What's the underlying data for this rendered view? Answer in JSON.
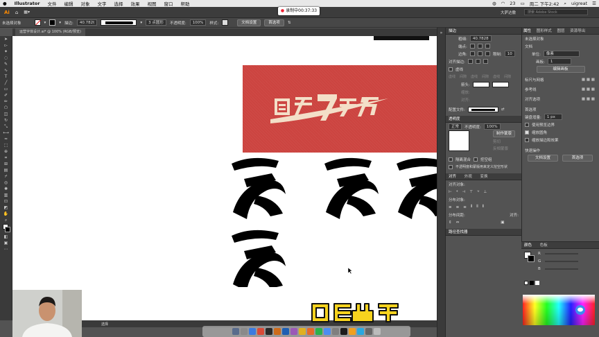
{
  "menubar": {
    "items": [
      "Illustrator",
      "文件",
      "编辑",
      "对象",
      "文字",
      "选择",
      "效果",
      "视图",
      "窗口",
      "帮助"
    ],
    "status_num": "23",
    "clock": "周二 下午2:42",
    "user": "uigreat"
  },
  "apptab": {
    "workspace": "大萨达撒",
    "search_placeholder": "搜索 Adobe Stock"
  },
  "recording": "录制中00:37:33",
  "control": {
    "selection": "未选择对象",
    "stroke_label": "描边:",
    "stroke_value": "40.782t",
    "brush": "3 点圆形",
    "opacity_label": "不透明度:",
    "opacity_value": "100%",
    "style_label": "样式:",
    "doc_setup": "文档设置",
    "preferences": "首选项"
  },
  "doctab": {
    "title": "运营字体设计.ai* @ 100% (RGB/预览)"
  },
  "statusbar": {
    "tool": "选择"
  },
  "stroke_panel": {
    "tab": "描边",
    "weight_label": "粗细:",
    "weight_value": "40.7828",
    "cap_label": "端点:",
    "corner_label": "边角:",
    "limit_label": "限制:",
    "limit_value": "10",
    "align_label": "对齐描边:",
    "dashed_label": "虚线",
    "dash_labels": [
      "虚线",
      "间隙",
      "虚线",
      "间隙",
      "虚线",
      "间隙"
    ],
    "arrow_label": "箭头:",
    "scale_label": "缩放:",
    "align2_label": "对齐:",
    "profile_label": "配置文件:"
  },
  "transparency_panel": {
    "tab": "透明度",
    "mode": "正常",
    "opacity_label": "不透明度:",
    "opacity_value": "100%",
    "make_mask": "制作蒙版",
    "clip": "剪切",
    "invert_mask": "反相蒙版",
    "isolate_blend": "隔离混合",
    "knockout_group": "挖空组",
    "opacity_mask_shape": "不透明度和蒙版用来定义挖空形状"
  },
  "align_panel": {
    "tabs": [
      "对齐",
      "外观",
      "变换"
    ],
    "align_objects": "对齐对象:",
    "distribute_objects": "分布对象:",
    "distribute_spacing": "分布间距:",
    "align_to": "对齐:"
  },
  "pathfinder": {
    "tab": "路径查找器"
  },
  "properties_panel": {
    "tabs": [
      "属性",
      "图形样式",
      "图层",
      "资源导出"
    ],
    "no_selection": "未选择对象",
    "document": "文档",
    "units_label": "单位:",
    "units_value": "像素",
    "artboard_label": "画板:",
    "artboard_value": "1",
    "edit_artboard": "编辑画板",
    "rulers_grids": "标尺与网格",
    "guides": "参考线",
    "snap": "对齐选项",
    "preferences": "首选项",
    "keyboard_inc_label": "键盘增量:",
    "keyboard_inc_value": "1 px",
    "preview_bounds": "使用预览边界",
    "scale_corners": "缩放圆角",
    "scale_strokes": "缩放描边和效果",
    "quick_actions": "快速操作",
    "doc_setup": "文档设置",
    "prefs_btn": "首选项"
  },
  "color_panel": {
    "tabs": [
      "颜色",
      "色板"
    ],
    "channels": [
      "R",
      "G",
      "B"
    ]
  },
  "colors": {
    "banner": "#cc4440",
    "banner_text": "#f3dfc8",
    "glyph": "#000000",
    "caption_fill": "#f6d31e",
    "caption_stroke": "#111111"
  }
}
